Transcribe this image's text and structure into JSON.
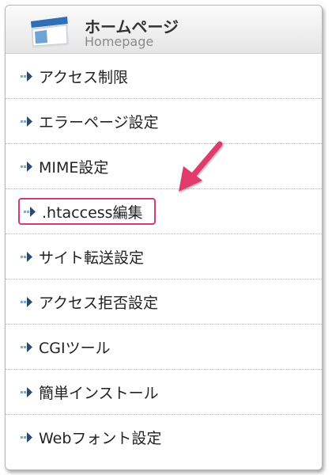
{
  "header": {
    "title": "ホームページ",
    "subtitle": "Homepage",
    "icon": "browser-window-icon"
  },
  "menu": {
    "items": [
      {
        "label": "アクセス制限"
      },
      {
        "label": "エラーページ設定"
      },
      {
        "label": "MIME設定"
      },
      {
        "label": ".htaccess編集",
        "highlighted": true
      },
      {
        "label": "サイト転送設定"
      },
      {
        "label": "アクセス拒否設定"
      },
      {
        "label": "CGIツール"
      },
      {
        "label": "簡単インストール"
      },
      {
        "label": "Webフォント設定"
      }
    ]
  },
  "colors": {
    "highlight": "#d23d75",
    "pointer_arrow": "#e03a6c",
    "bullet_dark": "#2c4a6a",
    "bullet_light": "#86a8c6"
  }
}
